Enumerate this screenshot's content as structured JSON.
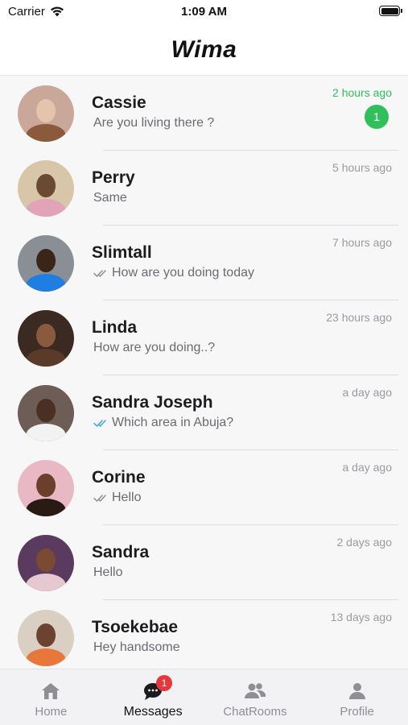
{
  "status_bar": {
    "carrier": "Carrier",
    "time": "1:09 AM"
  },
  "header": {
    "title": "Wima"
  },
  "chats": [
    {
      "name": "Cassie",
      "message": "Are you living there ?",
      "time": "2 hours ago",
      "unread": "1",
      "read_receipt": "none",
      "time_active": true,
      "avatar_colors": {
        "bg": "#c9a89a",
        "face": "#e6c3ad",
        "body": "#8b5a3c"
      }
    },
    {
      "name": "Perry",
      "message": "Same",
      "time": "5 hours ago",
      "unread": "",
      "read_receipt": "none",
      "time_active": false,
      "avatar_colors": {
        "bg": "#d7c6a8",
        "face": "#6b4a33",
        "body": "#e0a3b8"
      }
    },
    {
      "name": "Slimtall",
      "message": "How are you doing today",
      "time": "7 hours ago",
      "unread": "",
      "read_receipt": "grey",
      "time_active": false,
      "avatar_colors": {
        "bg": "#8a8f96",
        "face": "#3b2519",
        "body": "#1f7fe0"
      }
    },
    {
      "name": "Linda",
      "message": "How are you doing..?",
      "time": "23 hours ago",
      "unread": "",
      "read_receipt": "none",
      "time_active": false,
      "avatar_colors": {
        "bg": "#3a2a22",
        "face": "#8a5a3f",
        "body": "#5a3a28"
      }
    },
    {
      "name": "Sandra Joseph",
      "message": "Which area in Abuja?",
      "time": "a day ago",
      "unread": "",
      "read_receipt": "blue",
      "time_active": false,
      "avatar_colors": {
        "bg": "#6e5d56",
        "face": "#4a3023",
        "body": "#f2f2f2"
      }
    },
    {
      "name": "Corine",
      "message": "Hello",
      "time": "a day ago",
      "unread": "",
      "read_receipt": "grey",
      "time_active": false,
      "avatar_colors": {
        "bg": "#e8b8c4",
        "face": "#6b3f2c",
        "body": "#2a1a14"
      }
    },
    {
      "name": "Sandra",
      "message": "Hello",
      "time": "2 days ago",
      "unread": "",
      "read_receipt": "none",
      "time_active": false,
      "avatar_colors": {
        "bg": "#5a3a5e",
        "face": "#7a4a33",
        "body": "#e6c8d0"
      }
    },
    {
      "name": "Tsoekebae",
      "message": "Hey handsome",
      "time": "13 days ago",
      "unread": "",
      "read_receipt": "none",
      "time_active": false,
      "avatar_colors": {
        "bg": "#d9cfc2",
        "face": "#6b4330",
        "body": "#e7773a"
      }
    }
  ],
  "tabs": [
    {
      "label": "Home",
      "icon": "home-icon",
      "badge": ""
    },
    {
      "label": "Messages",
      "icon": "chat-bubble-icon",
      "badge": "1"
    },
    {
      "label": "ChatRooms",
      "icon": "group-icon",
      "badge": ""
    },
    {
      "label": "Profile",
      "icon": "person-icon",
      "badge": ""
    }
  ],
  "colors": {
    "accent_green": "#2fbf5b",
    "badge_red": "#e5383b",
    "read_blue": "#3ba4e6",
    "read_grey": "#8e8e93"
  }
}
